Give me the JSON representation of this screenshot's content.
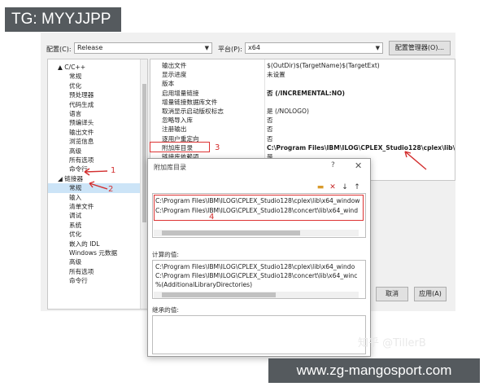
{
  "watermark_top": "TG: MYYJJPP",
  "watermark_bottom": "www.zg-mangosport.com",
  "zhihu_watermark": "知乎 @TillerB",
  "toolbar": {
    "config_label": "配置(C):",
    "config_value": "Release",
    "platform_label": "平台(P):",
    "platform_value": "x64",
    "config_manager_label": "配置管理器(O)..."
  },
  "tree": {
    "items": [
      {
        "label": "▲ C/C++",
        "indent": 0
      },
      {
        "label": "常规",
        "indent": 1
      },
      {
        "label": "优化",
        "indent": 1
      },
      {
        "label": "预处理器",
        "indent": 1
      },
      {
        "label": "代码生成",
        "indent": 1
      },
      {
        "label": "语言",
        "indent": 1
      },
      {
        "label": "预编译头",
        "indent": 1
      },
      {
        "label": "输出文件",
        "indent": 1
      },
      {
        "label": "浏览信息",
        "indent": 1
      },
      {
        "label": "高级",
        "indent": 1
      },
      {
        "label": "所有选项",
        "indent": 1
      },
      {
        "label": "命令行",
        "indent": 1
      },
      {
        "label": "◢ 链接器",
        "indent": 0
      },
      {
        "label": "常规",
        "indent": 1,
        "selected": true
      },
      {
        "label": "输入",
        "indent": 1
      },
      {
        "label": "清单文件",
        "indent": 1
      },
      {
        "label": "调试",
        "indent": 1
      },
      {
        "label": "系统",
        "indent": 1
      },
      {
        "label": "优化",
        "indent": 1
      },
      {
        "label": "嵌入的 IDL",
        "indent": 1
      },
      {
        "label": "Windows 元数据",
        "indent": 1
      },
      {
        "label": "高级",
        "indent": 1
      },
      {
        "label": "所有选项",
        "indent": 1
      },
      {
        "label": "命令行",
        "indent": 1
      }
    ]
  },
  "properties": [
    {
      "name": "输出文件",
      "value": "$(OutDir)$(TargetName)$(TargetExt)",
      "bold": false
    },
    {
      "name": "显示进度",
      "value": "未设置",
      "bold": false
    },
    {
      "name": "版本",
      "value": "",
      "bold": false
    },
    {
      "name": "启用增量链接",
      "value": "否 (/INCREMENTAL:NO)",
      "bold": true
    },
    {
      "name": "增量链接数据库文件",
      "value": "",
      "bold": false
    },
    {
      "name": "取消显示启动版权标志",
      "value": "是 (/NOLOGO)",
      "bold": false
    },
    {
      "name": "忽略导入库",
      "value": "否",
      "bold": false
    },
    {
      "name": "注册输出",
      "value": "否",
      "bold": false
    },
    {
      "name": "逐用户重定向",
      "value": "否",
      "bold": false
    },
    {
      "name": "附加库目录",
      "value": "C:\\Program Files\\IBM\\ILOG\\CPLEX_Studio128\\cplex\\lib\\x",
      "bold": true
    },
    {
      "name": "链接库依赖项",
      "value": "是",
      "bold": false
    }
  ],
  "dialog": {
    "title": "附加库目录",
    "help": "?",
    "close": "✕",
    "list_lines": [
      "C:\\Program Files\\IBM\\ILOG\\CPLEX_Studio128\\cplex\\lib\\x64_window",
      "C:\\Program Files\\IBM\\ILOG\\CPLEX_Studio128\\concert\\lib\\x64_wind"
    ],
    "computed_label": "计算的值:",
    "computed_lines": [
      "C:\\Program Files\\IBM\\ILOG\\CPLEX_Studio128\\cplex\\lib\\x64_windo",
      "C:\\Program Files\\IBM\\ILOG\\CPLEX_Studio128\\concert\\lib\\x64_winc",
      "%(AdditionalLibraryDirectories)"
    ],
    "inherited_label": "继承的值:"
  },
  "bottom_buttons": {
    "cancel": "取消",
    "apply": "应用(A)"
  },
  "annotations": {
    "n1": "1",
    "n2": "2",
    "n3": "3",
    "n4": "4"
  },
  "colors": {
    "annotation_red": "#d32f2f",
    "selection_blue": "#cce4f7",
    "watermark_bg": "#555a5e"
  }
}
